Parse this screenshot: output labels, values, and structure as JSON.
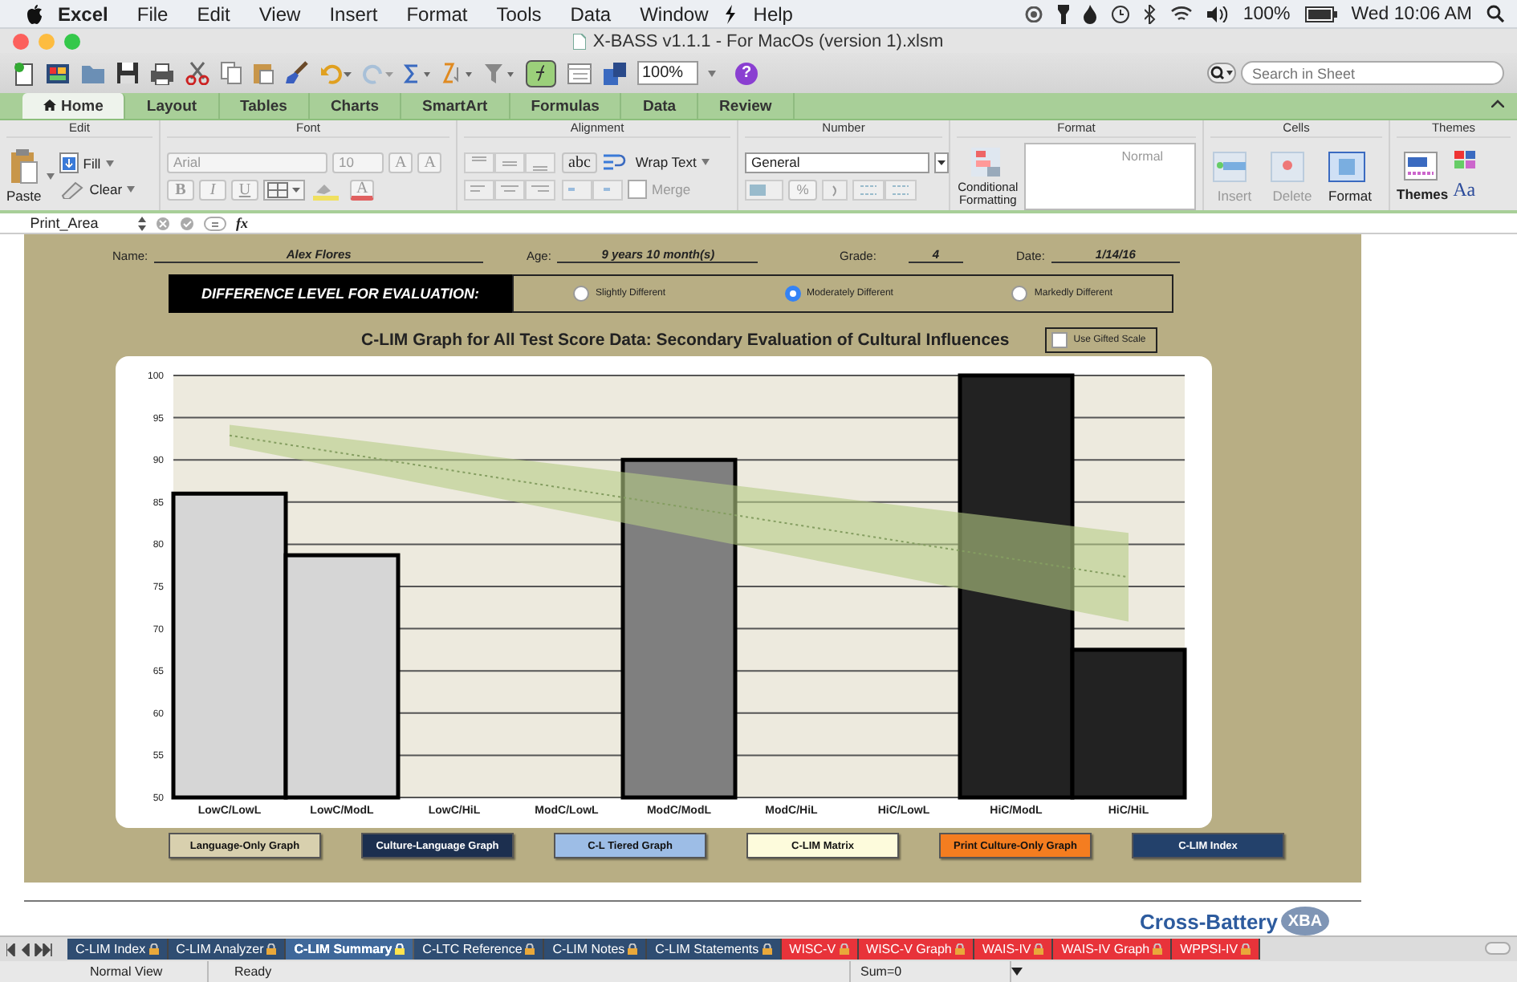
{
  "menu_bar": {
    "app": "Excel",
    "menus": [
      "File",
      "Edit",
      "View",
      "Insert",
      "Format",
      "Tools",
      "Data",
      "Window",
      "Help"
    ],
    "battery": "100%",
    "clock": "Wed 10:06 AM"
  },
  "window": {
    "title": "X-BASS v1.1.1 - For MacOs (version 1).xlsm"
  },
  "toolbar": {
    "zoom": "100%",
    "help": "?",
    "search": {
      "placeholder": "Search in Sheet"
    }
  },
  "ribbon": {
    "tabs": [
      {
        "label": "Home",
        "selected": true
      },
      {
        "label": "Layout",
        "selected": false
      },
      {
        "label": "Tables",
        "selected": false
      },
      {
        "label": "Charts",
        "selected": false
      },
      {
        "label": "SmartArt",
        "selected": false
      },
      {
        "label": "Formulas",
        "selected": false
      },
      {
        "label": "Data",
        "selected": false
      },
      {
        "label": "Review",
        "selected": false
      }
    ],
    "edit": {
      "title": "Edit",
      "paste": "Paste",
      "fill": "Fill",
      "clear": "Clear"
    },
    "font": {
      "title": "Font",
      "family": "Arial",
      "size": "10",
      "grow": "A",
      "shrink": "A",
      "bold": "B",
      "italic": "I",
      "underline": "U",
      "font_color_label": "A"
    },
    "alignment": {
      "title": "Alignment",
      "orientation": "abc",
      "wrap": "Wrap Text",
      "merge": "Merge"
    },
    "number": {
      "title": "Number",
      "format": "General",
      "percent": "%"
    },
    "format": {
      "title": "Format",
      "conditional": "Conditional Formatting",
      "style": "Normal"
    },
    "cells": {
      "title": "Cells",
      "insert": "Insert",
      "delete": "Delete",
      "format": "Format"
    },
    "themes": {
      "title": "Themes",
      "themes": "Themes",
      "fonts": "Aa"
    }
  },
  "formula_bar": {
    "name_box": "Print_Area",
    "fx": "fx"
  },
  "form": {
    "fields": [
      {
        "label": "Name:",
        "value": "Alex Flores"
      },
      {
        "label": "Age:",
        "value": "9 years 10 month(s)"
      },
      {
        "label": "Grade:",
        "value": "4"
      },
      {
        "label": "Date:",
        "value": "1/14/16"
      }
    ],
    "difference": {
      "label": "DIFFERENCE LEVEL FOR EVALUATION:",
      "options": [
        {
          "label": "Slightly Different",
          "selected": false
        },
        {
          "label": "Moderately Different",
          "selected": true
        },
        {
          "label": "Markedly Different",
          "selected": false
        }
      ]
    },
    "gifted": {
      "label": "Use Gifted Scale",
      "checked": false
    },
    "chart": {
      "chart_data": {
        "type": "bar",
        "title": "C-LIM Graph for All Test Score Data: Secondary Evaluation of Cultural Influences",
        "categories": [
          "LowC/LowL",
          "LowC/ModL",
          "LowC/HiL",
          "ModC/LowL",
          "ModC/ModL",
          "ModC/HiL",
          "HiC/LowL",
          "HiC/ModL",
          "HiC/HiL"
        ],
        "series": [
          {
            "color": "#d6d6d6",
            "values": [
              86,
              78.7,
              null,
              null,
              null,
              null,
              null,
              null,
              null
            ]
          },
          {
            "color": "#7f7f7f",
            "values": [
              null,
              null,
              null,
              null,
              90,
              null,
              null,
              null,
              null
            ]
          },
          {
            "color": "#222222",
            "values": [
              null,
              null,
              null,
              null,
              null,
              null,
              null,
              100,
              67.5
            ]
          },
          {
            "type": "line",
            "color": "#3c5a2c",
            "line_style": "dotted",
            "values": [
              92.9,
              90.8,
              88.7,
              86.6,
              84.5,
              82.4,
              80.3,
              78.2,
              76.1
            ]
          }
        ],
        "stacked": true,
        "grid": true,
        "ylim": [
          50,
          100
        ],
        "yticks": [
          50,
          55,
          60,
          65,
          70,
          75,
          80,
          85,
          90,
          95,
          100
        ]
      }
    },
    "buttons": [
      {
        "label": "Language-Only Graph",
        "color": "#d8d0ae"
      },
      {
        "label": "Culture-Language Graph",
        "color": "#1c2f4f"
      },
      {
        "label": "C-L Tiered Graph",
        "color": "#9dbde6"
      },
      {
        "label": "C-LIM Matrix",
        "color": "#fdfbdc"
      },
      {
        "label": "Print Culture-Only Graph",
        "color": "#f47d20"
      },
      {
        "label": "C-LIM Index",
        "color": "#23416b"
      }
    ]
  },
  "logo": {
    "text": "Cross-Battery",
    "badge": "XBA"
  },
  "sheet_tabs": [
    {
      "label": "C-LIM Index",
      "selected": false,
      "color": "#2f4d72"
    },
    {
      "label": "C-LIM Analyzer",
      "selected": false,
      "color": "#2f4d72"
    },
    {
      "label": "C-LIM Summary",
      "selected": true,
      "color": "#2f4d72"
    },
    {
      "label": "C-LTC Reference",
      "selected": false,
      "color": "#2f4d72"
    },
    {
      "label": "C-LIM Notes",
      "selected": false,
      "color": "#2f4d72"
    },
    {
      "label": "C-LIM Statements",
      "selected": false,
      "color": "#2f4d72"
    },
    {
      "label": "WISC-V",
      "selected": false,
      "color": "#e8333a"
    },
    {
      "label": "WISC-V Graph",
      "selected": false,
      "color": "#e8333a"
    },
    {
      "label": "WAIS-IV",
      "selected": false,
      "color": "#e8333a"
    },
    {
      "label": "WAIS-IV Graph",
      "selected": false,
      "color": "#e8333a"
    },
    {
      "label": "WPPSI-IV",
      "selected": false,
      "color": "#e8333a"
    }
  ],
  "status_bar": {
    "view": "Normal View",
    "mode": "Ready",
    "sum": "Sum=0"
  }
}
